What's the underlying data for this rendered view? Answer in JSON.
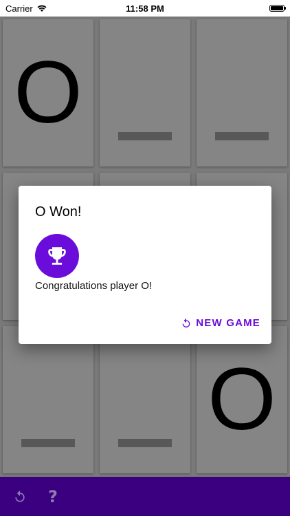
{
  "status_bar": {
    "carrier": "Carrier",
    "time": "11:58 PM"
  },
  "board": {
    "cells": [
      {
        "mark": "O"
      },
      {
        "mark": ""
      },
      {
        "mark": ""
      },
      {
        "mark": ""
      },
      {
        "mark": ""
      },
      {
        "mark": ""
      },
      {
        "mark": ""
      },
      {
        "mark": ""
      },
      {
        "mark": "O"
      }
    ]
  },
  "dialog": {
    "title": "O Won!",
    "icon": "trophy-icon",
    "message": "Congratulations player O!",
    "action_label": "NEW GAME",
    "action_icon": "restart-icon"
  },
  "toolbar": {
    "items": [
      "restart-icon",
      "help-icon"
    ],
    "help_glyph": "?"
  },
  "colors": {
    "accent": "#6a0dda",
    "toolbar": "#3b0080",
    "board": "#7a7a7a"
  }
}
